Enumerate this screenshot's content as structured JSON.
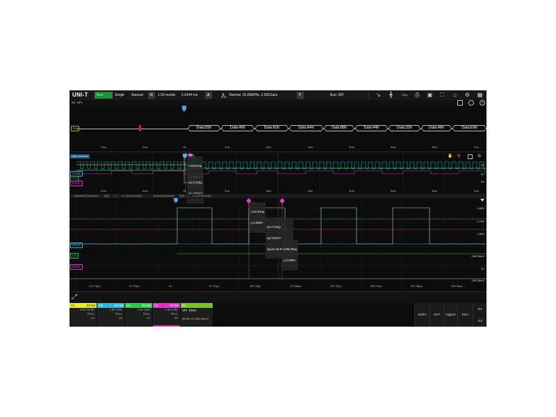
{
  "toolbar": {
    "logo": "UNI-T",
    "run_state": "Run",
    "single": "Single",
    "autoset": "Autoset",
    "h_label": "H",
    "timebase": "1.00 ms/div",
    "h_position": "2.2444 ms",
    "a_label": "A",
    "acq_mode": "Normal, 25.00MPts, 2.50GSa/s",
    "t_label": "T",
    "trigger": "Bus: SPI",
    "acq_icon": "Acq"
  },
  "subbar": {
    "label": "B1: SPI"
  },
  "decode_row": {
    "channel_tag": "B1",
    "items": [
      "Data:18h",
      "Data:C9h",
      "Data:55h",
      "Data:46h",
      "Data:E0h",
      "Data:A4h",
      "Data:88h",
      "Data:44h",
      "Data:32h",
      "Data:46h",
      "Data:E8h"
    ]
  },
  "top_axis_ticks": [
    "-2ms",
    "-1ms",
    "0s",
    "1ms",
    "2ms",
    "3ms",
    "4ms",
    "5ms",
    "6ms",
    "7ms"
  ],
  "main_window": {
    "label": "Main Window",
    "channel_tags": [
      "SCLK",
      "CS",
      "MOSI"
    ],
    "cursor_a": [
      "x:83.544µ",
      "y:2.988V"
    ],
    "cursor_delta": [
      "Δx:2.218µ",
      "Δy:100mV"
    ],
    "levels": [
      "3V",
      "0V",
      "0V"
    ],
    "axis_ticks": [
      "-2ms",
      "-1ms",
      "0s",
      "1ms",
      "2ms",
      "3ms",
      "4ms",
      "5ms",
      "6ms",
      "7ms"
    ]
  },
  "zoom_bar": {
    "horizontal": "Horizontal Expansion",
    "mid": "1:1 (244.4ms/div)",
    "vertical": "Vertical Expansion",
    "right": "1:1 (50.0mV/div)"
  },
  "zoom_window": {
    "volt_labels": [
      "4.69V",
      "3.75V",
      "2.82V",
      "-138.36mV",
      "0V",
      "-138.36mV"
    ],
    "channel_tags": [
      "SCLK",
      "CS",
      "MOSI"
    ],
    "cursor_a": [
      "x:83.544µ",
      "y:2.988V"
    ],
    "cursor_delta": [
      "Δx:2.218µ",
      "Δy:100mV",
      "Δy/Δx:45.083mV/µ"
    ],
    "cursor_b": [
      "x:85.762µ",
      "y:3.088V"
    ],
    "time_ticks": [
      "-115.79µs",
      "-57.91µs",
      "0s",
      "57.91µs",
      "115.79µs",
      "173.68µs",
      "231.57µs",
      "289.47µs",
      "347.36µs",
      "405.26µs"
    ]
  },
  "channels": [
    {
      "name": "C1",
      "coupling": "DC1M",
      "scale": "100 mV/div",
      "bw": "FULL",
      "probe": "1X",
      "color": "#e9ec33"
    },
    {
      "name": "C2",
      "coupling": "DC1M",
      "scale": "1.00 V/div",
      "bw": "FULL",
      "probe": "1X",
      "color": "#2fb6d9"
    },
    {
      "name": "C3",
      "coupling": "DC1M",
      "scale": "1.00 V/div",
      "bw": "FULL",
      "probe": "1X",
      "color": "#2ec84a"
    },
    {
      "name": "C4",
      "coupling": "DC1M",
      "scale": "1.00 V/div",
      "bw": "FULL",
      "probe": "1X",
      "color": "#d736c9"
    }
  ],
  "bus_card": {
    "name": "B1",
    "type": "SPI",
    "mode": "Slave",
    "source": "MOSI:>C4 500.00mV",
    "color": "#7bbf2a"
  },
  "right_buttons": [
    "Math+",
    "Ref+",
    "Digital+",
    "Bus+"
  ],
  "g_buttons": [
    "G1",
    "G2"
  ],
  "colors": {
    "background": "#0c0c0c",
    "sclk": "#2fb6d9",
    "cs": "#2ec84a",
    "mosi": "#d736c9",
    "bus": "#7bbf2a",
    "marker": "#e040c8",
    "c1": "#e9ec33"
  }
}
